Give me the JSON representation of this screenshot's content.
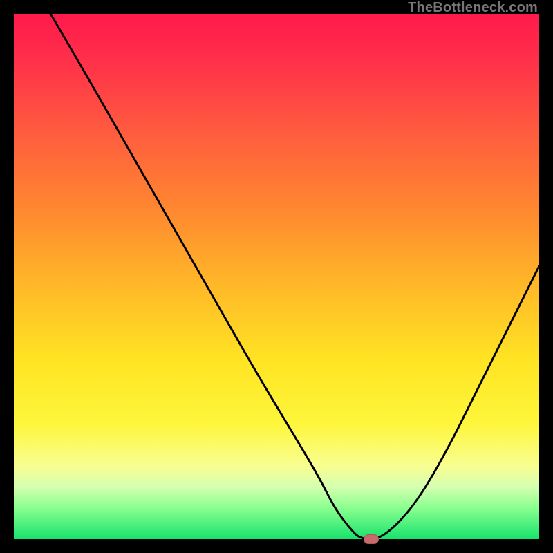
{
  "attribution": "TheBottleneck.com",
  "colors": {
    "frame": "#000000",
    "curve": "#000000",
    "marker": "#c96a6a",
    "gradient_stops": [
      "#ff1a4b",
      "#ff2d4a",
      "#ff5a3f",
      "#ff8a2f",
      "#ffb928",
      "#ffe423",
      "#fef63b",
      "#f8fe90",
      "#d6ffb0",
      "#8bff90",
      "#16e36b"
    ]
  },
  "chart_data": {
    "type": "line",
    "title": "",
    "xlabel": "",
    "ylabel": "",
    "xlim": [
      0,
      100
    ],
    "ylim": [
      0,
      100
    ],
    "series": [
      {
        "name": "bottleneck-curve",
        "x": [
          7,
          14,
          22,
          30,
          38,
          46,
          52,
          58,
          61,
          64,
          66,
          70,
          76,
          82,
          88,
          94,
          100
        ],
        "y": [
          100,
          88,
          74,
          60,
          46,
          32,
          22,
          12,
          6,
          2,
          0,
          0,
          6,
          16,
          28,
          40,
          52
        ]
      }
    ],
    "annotations": [
      {
        "name": "optimal-marker",
        "x": 68,
        "y": 0
      }
    ]
  }
}
